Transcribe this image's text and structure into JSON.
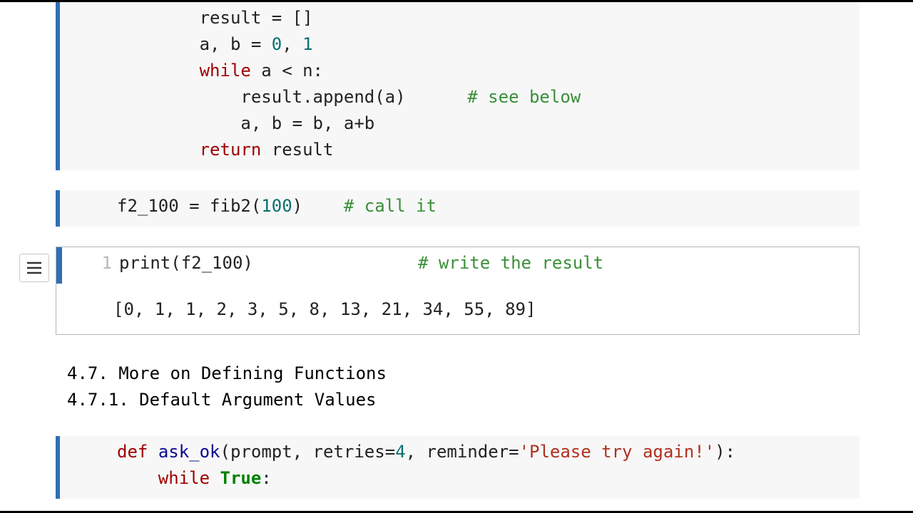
{
  "cells": {
    "fib2_body": {
      "lines": [
        {
          "indent": "        ",
          "tokens": [
            [
              "",
              "result = []"
            ]
          ]
        },
        {
          "indent": "        ",
          "tokens": [
            [
              "",
              "a, b = "
            ],
            [
              "nm",
              "0"
            ],
            [
              "",
              ", "
            ],
            [
              "nm",
              "1"
            ]
          ]
        },
        {
          "indent": "        ",
          "tokens": [
            [
              "kwr",
              "while"
            ],
            [
              "",
              " a < n:"
            ]
          ]
        },
        {
          "indent": "            ",
          "tokens": [
            [
              "",
              "result.append(a)      "
            ],
            [
              "cm",
              "# see below"
            ]
          ]
        },
        {
          "indent": "            ",
          "tokens": [
            [
              "",
              "a, b = b, a+b"
            ]
          ]
        },
        {
          "indent": "        ",
          "tokens": [
            [
              "kwr",
              "return"
            ],
            [
              "",
              " result"
            ]
          ]
        }
      ]
    },
    "call_cell": {
      "lines": [
        {
          "indent": "",
          "tokens": [
            [
              "",
              "f2_100 = fib2("
            ],
            [
              "nm",
              "100"
            ],
            [
              "",
              ")    "
            ],
            [
              "cm",
              "# call it"
            ]
          ]
        }
      ]
    },
    "print_cell": {
      "line_number": "1",
      "lines": [
        {
          "indent": "",
          "tokens": [
            [
              "",
              "print(f2_100)                "
            ],
            [
              "cm",
              "# write the result"
            ]
          ]
        }
      ],
      "output": "[0, 1, 1, 2, 3, 5, 8, 13, 21, 34, 55, 89]"
    },
    "markdown": {
      "line1": "4.7. More on Defining Functions",
      "line2": "4.7.1. Default Argument Values"
    },
    "askok_cell": {
      "lines": [
        {
          "indent": "",
          "tokens": [
            [
              "kwr",
              "def"
            ],
            [
              "",
              " "
            ],
            [
              "fn",
              "ask_ok"
            ],
            [
              "",
              "(prompt, retries="
            ],
            [
              "nm",
              "4"
            ],
            [
              "",
              ", reminder="
            ],
            [
              "st",
              "'Please try again!'"
            ],
            [
              "",
              "):"
            ]
          ]
        },
        {
          "indent": "    ",
          "tokens": [
            [
              "kwr",
              "while"
            ],
            [
              "",
              " "
            ],
            [
              "kw",
              "True"
            ],
            [
              "",
              ":"
            ]
          ]
        }
      ]
    }
  },
  "icons": {
    "menu": "hamburger-icon"
  }
}
